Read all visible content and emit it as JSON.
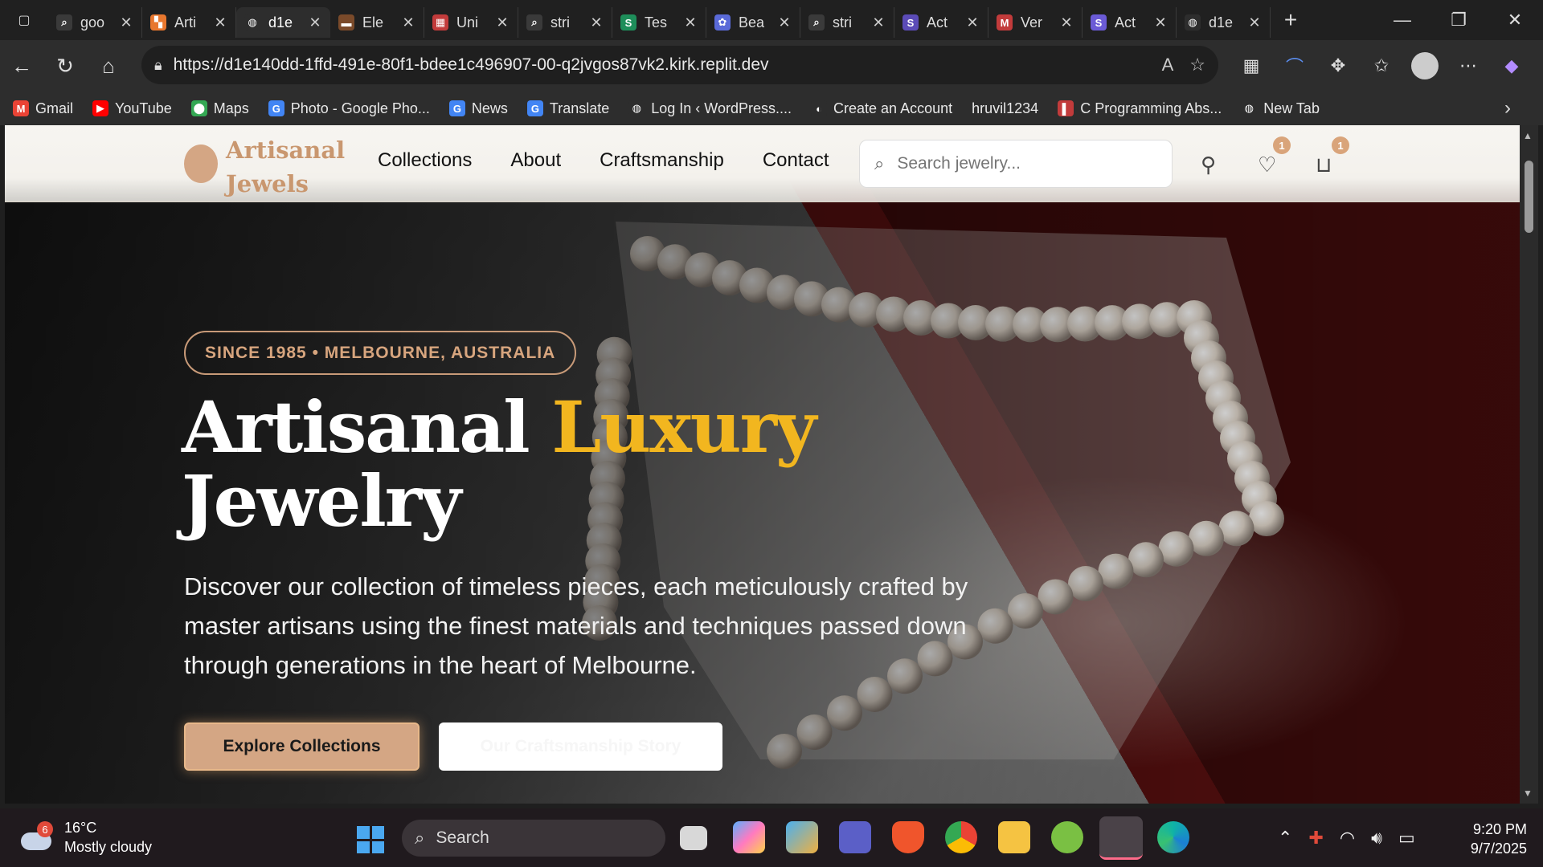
{
  "browser": {
    "tabs": [
      {
        "label": "goo",
        "color": "#3a3a3a",
        "glyph": "⌕"
      },
      {
        "label": "Arti",
        "color": "#e8772e",
        "glyph": "▚"
      },
      {
        "label": "d1e",
        "color": "#2d2d2d",
        "glyph": "◍",
        "active": true
      },
      {
        "label": "Ele",
        "color": "#7a4a2a",
        "glyph": "▬"
      },
      {
        "label": "Uni",
        "color": "#c23b3b",
        "glyph": "▦"
      },
      {
        "label": "stri",
        "color": "#3a3a3a",
        "glyph": "⌕"
      },
      {
        "label": "Tes",
        "color": "#1e8e5a",
        "glyph": "S"
      },
      {
        "label": "Bea",
        "color": "#5a6ad8",
        "glyph": "✿"
      },
      {
        "label": "stri",
        "color": "#3a3a3a",
        "glyph": "⌕"
      },
      {
        "label": "Act",
        "color": "#5b4bb7",
        "glyph": "S"
      },
      {
        "label": "Ver",
        "color": "#c23b3b",
        "glyph": "M"
      },
      {
        "label": "Act",
        "color": "#6b5bd6",
        "glyph": "S"
      },
      {
        "label": "d1e",
        "color": "#2d2d2d",
        "glyph": "◍"
      }
    ],
    "url": "https://d1e140dd-1ffd-491e-80f1-bdee1c496907-00-q2jvgos87vk2.kirk.replit.dev",
    "bookmarks": [
      {
        "label": "Gmail",
        "icon": "gmail-icon",
        "color": "#ea4335",
        "glyph": "M"
      },
      {
        "label": "YouTube",
        "icon": "youtube-icon",
        "color": "#ff0000",
        "glyph": "▶"
      },
      {
        "label": "Maps",
        "icon": "maps-icon",
        "color": "#34a853",
        "glyph": "⬤"
      },
      {
        "label": "Photo - Google Pho...",
        "icon": "google-icon",
        "color": "#4285f4",
        "glyph": "G"
      },
      {
        "label": "News",
        "icon": "news-icon",
        "color": "#4285f4",
        "glyph": "G"
      },
      {
        "label": "Translate",
        "icon": "translate-icon",
        "color": "#4285f4",
        "glyph": "G"
      },
      {
        "label": "Log In ‹ WordPress....",
        "icon": "globe-icon",
        "color": "#2d2d2d",
        "glyph": "◍"
      },
      {
        "label": "Create an Account",
        "icon": "account-icon",
        "color": "#2d2d2d",
        "glyph": "◐"
      },
      {
        "label": "hruvil1234",
        "icon": "",
        "color": "#2d2d2d",
        "glyph": ""
      },
      {
        "label": "C Programming Abs...",
        "icon": "pdf-icon",
        "color": "#c23b3b",
        "glyph": "▌"
      },
      {
        "label": "New Tab",
        "icon": "globe-icon",
        "color": "#2d2d2d",
        "glyph": "◍"
      }
    ]
  },
  "site": {
    "logo_line1": "Artisanal",
    "logo_line2": "Jewels",
    "nav": [
      "Collections",
      "About",
      "Craftsmanship",
      "Contact"
    ],
    "search_placeholder": "Search jewelry...",
    "wishlist_count": "1",
    "cart_count": "1",
    "accent": "#d4a684",
    "hero": {
      "tagline": "SINCE 1985 • MELBOURNE, AUSTRALIA",
      "title_part1": "Artisanal",
      "title_part2": "Luxury",
      "title_part3": "Jewelry",
      "title_accent": "#f2b61f",
      "lead": "Discover our collection of timeless pieces, each meticulously crafted by master artisans using the finest materials and techniques passed down through generations in the heart of Melbourne.",
      "cta_primary": "Explore Collections",
      "cta_secondary": "Our Craftsmanship Story"
    }
  },
  "taskbar": {
    "weather_temp": "16°C",
    "weather_desc": "Mostly cloudy",
    "weather_badge": "6",
    "search_label": "Search",
    "time": "9:20 PM",
    "date": "9/7/2025"
  }
}
